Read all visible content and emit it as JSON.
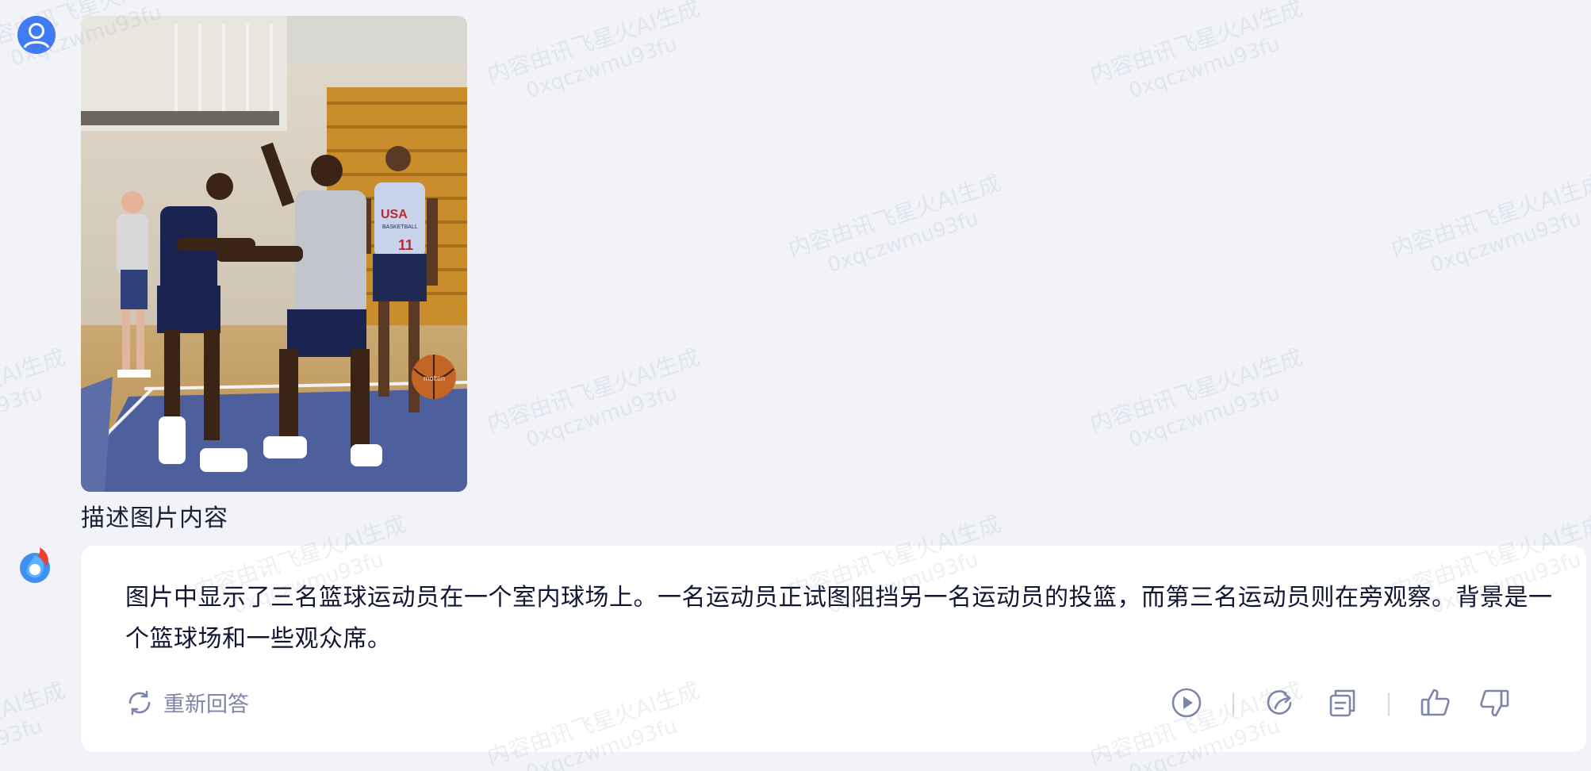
{
  "watermark": {
    "line1": "内容由讯飞星火AI生成",
    "line2": "0xqczwmu93fu"
  },
  "user_message": {
    "prompt_text": "描述图片内容",
    "image_jersey_text": "USA",
    "image_jersey_sub": "BASKETBALL",
    "image_jersey_number": "11",
    "image_ball_text": "molten"
  },
  "bot_message": {
    "answer_text": "图片中显示了三名篮球运动员在一个室内球场上。一名运动员正试图阻挡另一名运动员的投篮，而第三名运动员则在旁观察。背景是一个篮球场和一些观众席。",
    "regenerate_label": "重新回答"
  },
  "colors": {
    "page_bg": "#f1f3f9",
    "card_bg": "#ffffff",
    "icon_gray": "#7d86a8",
    "user_avatar_blue": "#3f7bf5"
  },
  "icons": [
    "user-avatar-icon",
    "spark-logo-icon",
    "refresh-icon",
    "play-icon",
    "share-icon",
    "copy-icon",
    "thumbs-up-icon",
    "thumbs-down-icon"
  ]
}
